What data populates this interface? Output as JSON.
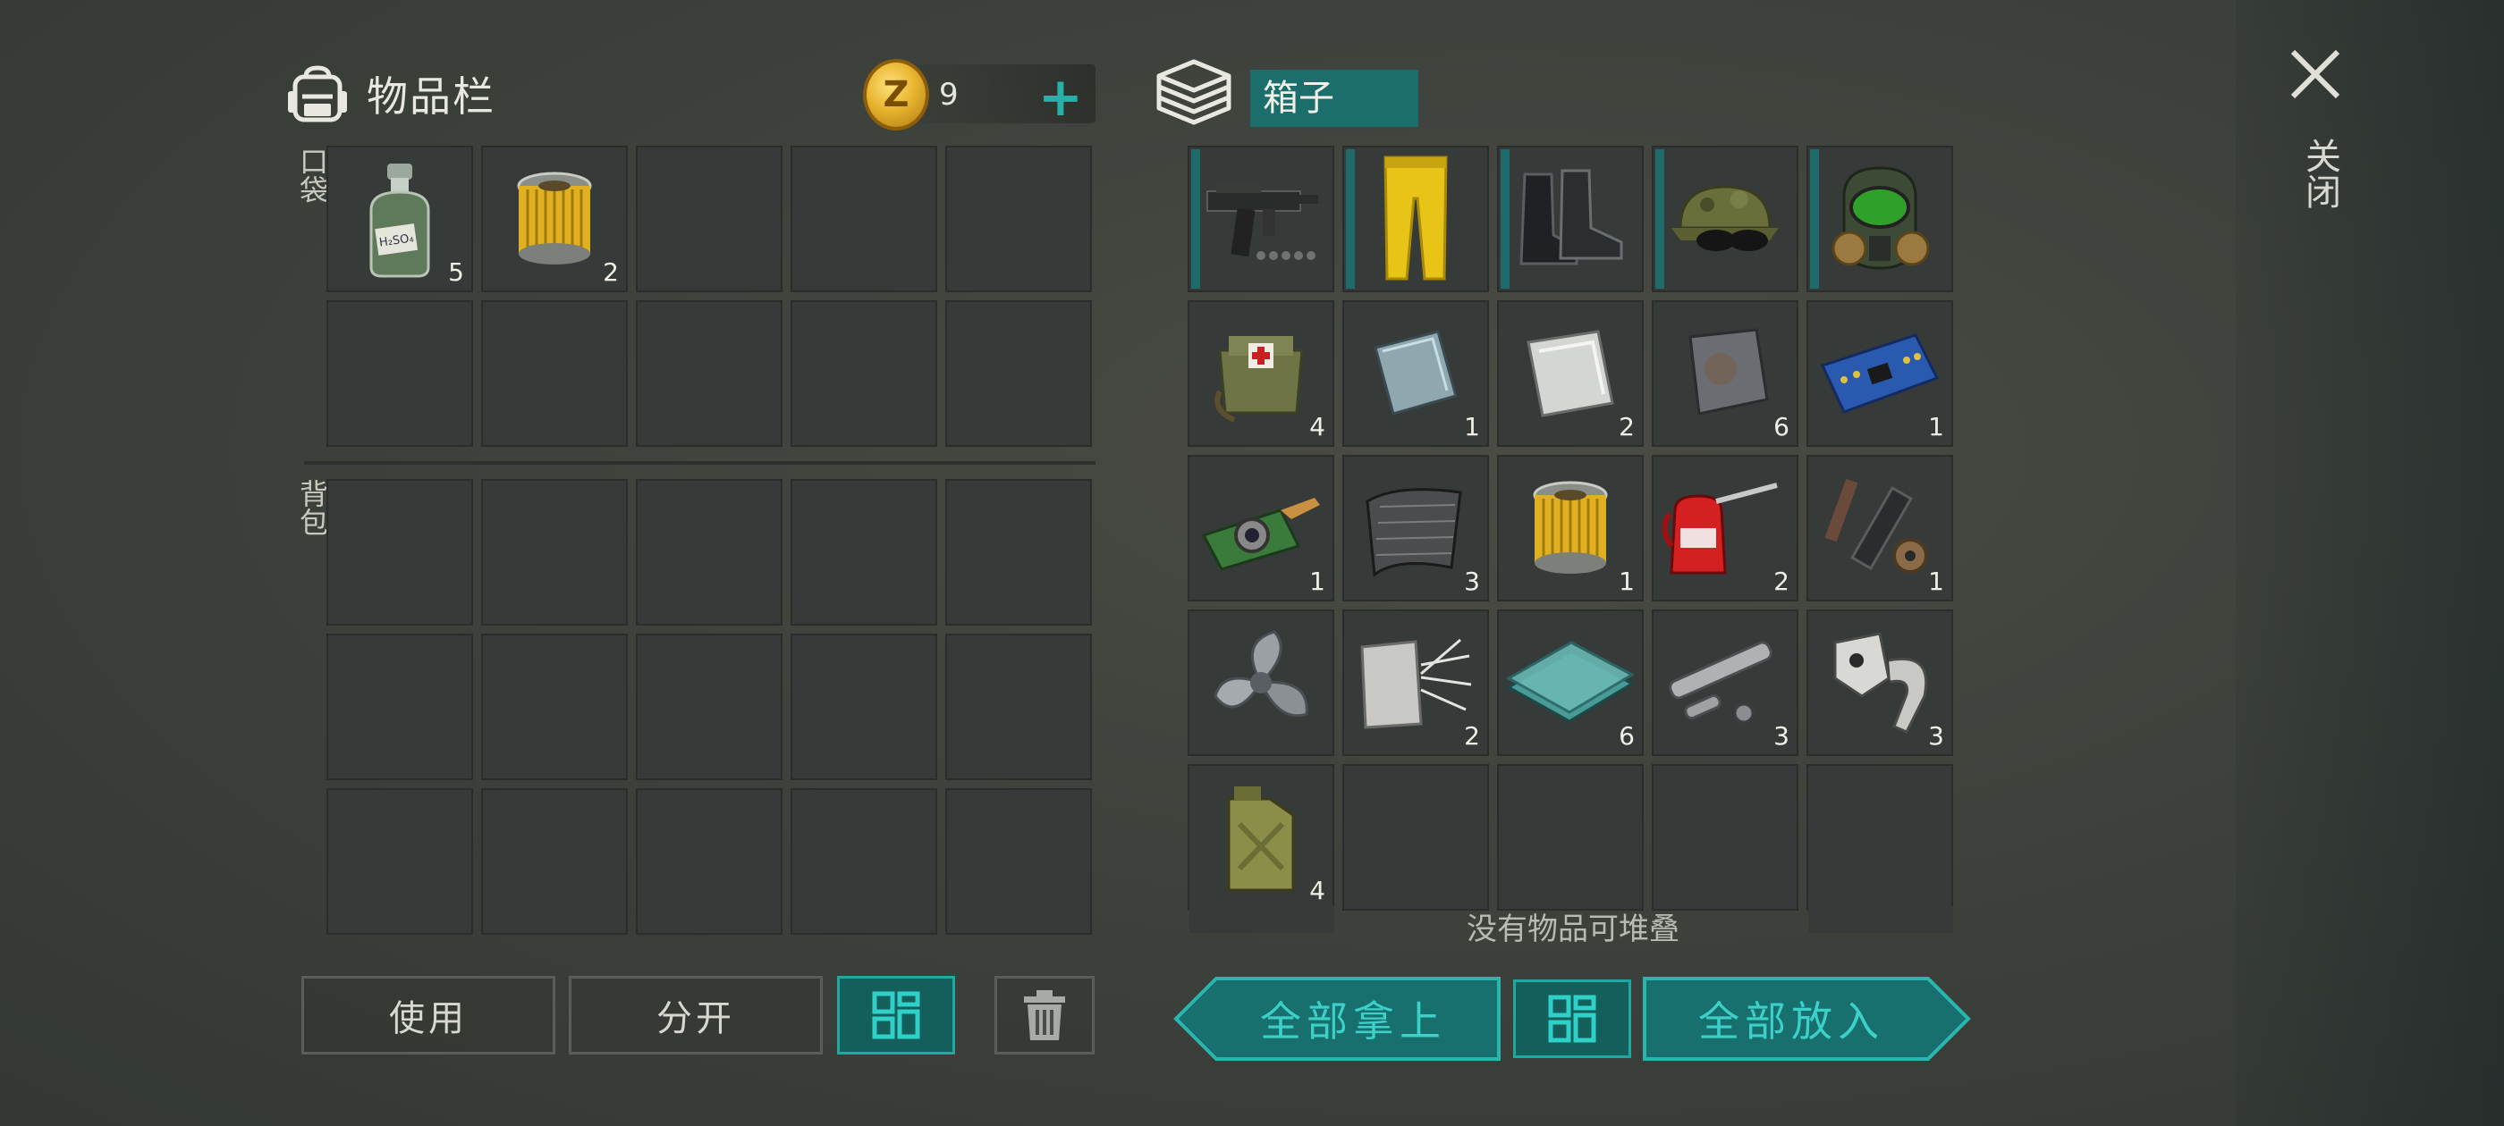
{
  "inventory": {
    "title": "物品栏",
    "currency_count": "9",
    "currency_symbol": "Z",
    "pocket_label": "口袋",
    "backpack_label": "背包",
    "pocket_items": [
      {
        "name": "acid-bottle-icon",
        "qty": "5",
        "label": "H₂SO₄"
      },
      {
        "name": "fuel-filter-icon",
        "qty": "2"
      }
    ],
    "buttons": {
      "use": "使用",
      "split": "分开"
    }
  },
  "box": {
    "title": "箱子",
    "items": [
      {
        "name": "uzi-gun-icon",
        "qty": "",
        "equip": true
      },
      {
        "name": "yellow-pants-icon",
        "qty": "",
        "equip": true
      },
      {
        "name": "boots-icon",
        "qty": "",
        "equip": true
      },
      {
        "name": "camo-cap-icon",
        "qty": "",
        "equip": true
      },
      {
        "name": "gas-mask-icon",
        "qty": "",
        "equip": true
      },
      {
        "name": "medkit-bag-icon",
        "qty": "4"
      },
      {
        "name": "steel-plate-icon",
        "qty": "1"
      },
      {
        "name": "aluminum-plate-icon",
        "qty": "2"
      },
      {
        "name": "iron-plate-icon",
        "qty": "6"
      },
      {
        "name": "circuit-board-icon",
        "qty": "1"
      },
      {
        "name": "camera-module-icon",
        "qty": "1"
      },
      {
        "name": "mesh-sheet-icon",
        "qty": "3"
      },
      {
        "name": "fuel-filter-icon",
        "qty": "1"
      },
      {
        "name": "oil-can-icon",
        "qty": "2"
      },
      {
        "name": "tool-parts-icon",
        "qty": "1"
      },
      {
        "name": "propeller-icon",
        "qty": ""
      },
      {
        "name": "fiber-cloth-icon",
        "qty": "2"
      },
      {
        "name": "glass-sheets-icon",
        "qty": "6"
      },
      {
        "name": "metal-pipes-icon",
        "qty": "3"
      },
      {
        "name": "mechanical-parts-icon",
        "qty": "3"
      },
      {
        "name": "jerrycan-icon",
        "qty": "4"
      }
    ],
    "hint": "没有物品可堆叠",
    "take_all": "全部拿上",
    "put_all": "全部放入"
  },
  "close_label": "关闭",
  "colors": {
    "accent": "#1fa9a3",
    "accent_dark": "#145e5c",
    "cell": "#363a38"
  }
}
